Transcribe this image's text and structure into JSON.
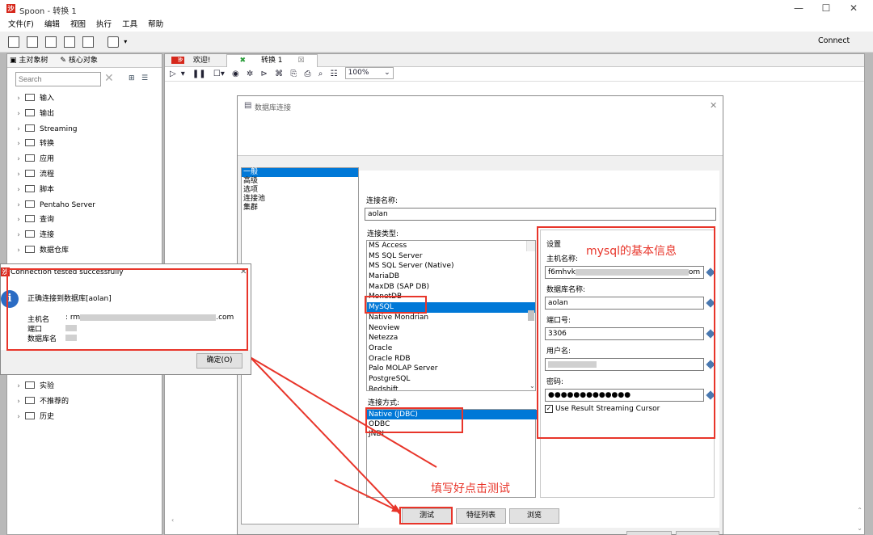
{
  "window": {
    "title": "Spoon - 转换 1",
    "connect_label": "Connect"
  },
  "menu": [
    "文件(F)",
    "编辑",
    "视图",
    "执行",
    "工具",
    "帮助"
  ],
  "left_panel": {
    "tabs": [
      "主对象树",
      "核心对象"
    ],
    "search_placeholder": "Search",
    "tree": [
      "输入",
      "输出",
      "Streaming",
      "转换",
      "应用",
      "流程",
      "脚本",
      "Pentaho Server",
      "查询",
      "连接",
      "数据仓库"
    ],
    "tree_bottom": [
      "实验",
      "不推荐的",
      "历史"
    ]
  },
  "editor": {
    "tabs": [
      "欢迎!",
      "转换 1"
    ],
    "zoom": "100%"
  },
  "db_dialog": {
    "title": "数据库连接",
    "categories": [
      "一般",
      "高级",
      "选项",
      "连接池",
      "集群"
    ],
    "conn_name_label": "连接名称:",
    "conn_name": "aolan",
    "conn_type_label": "连接类型:",
    "conn_types": [
      "MS Access",
      "MS SQL Server",
      "MS SQL Server (Native)",
      "MariaDB",
      "MaxDB (SAP DB)",
      "MonetDB",
      "MySQL",
      "Native Mondrian",
      "Neoview",
      "Netezza",
      "Oracle",
      "Oracle RDB",
      "Palo MOLAP Server",
      "PostgreSQL",
      "Redshift"
    ],
    "conn_type_selected": "MySQL",
    "access_label": "连接方式:",
    "access_methods": [
      "Native (JDBC)",
      "ODBC",
      "JNDI"
    ],
    "access_selected": "Native (JDBC)",
    "settings_title": "设置",
    "host_label": "主机名称:",
    "host_value_start": "f6mhvk",
    "host_value_end": "om",
    "dbname_label": "数据库名称:",
    "dbname_value": "aolan",
    "port_label": "端口号:",
    "port_value": "3306",
    "user_label": "用户名:",
    "password_label": "密码:",
    "password_value": "●●●●●●●●●●●●●",
    "streaming_cursor_label": "Use Result Streaming Cursor",
    "buttons": [
      "测试",
      "特征列表",
      "浏览"
    ]
  },
  "annotations": {
    "mysql_info": "mysql的基本信息",
    "fill_test": "填写好点击测试"
  },
  "popup": {
    "title": "Connection tested successfully",
    "message": "正确连接到数据库[aolan]",
    "host_label": "主机名",
    "host_prefix": ": rm",
    "host_suffix": ".com",
    "port_label": "端口",
    "db_label": "数据库名",
    "ok_button": "确定(O)"
  },
  "colors": {
    "selection": "#0078d7",
    "annotation_red": "#e8352a"
  }
}
